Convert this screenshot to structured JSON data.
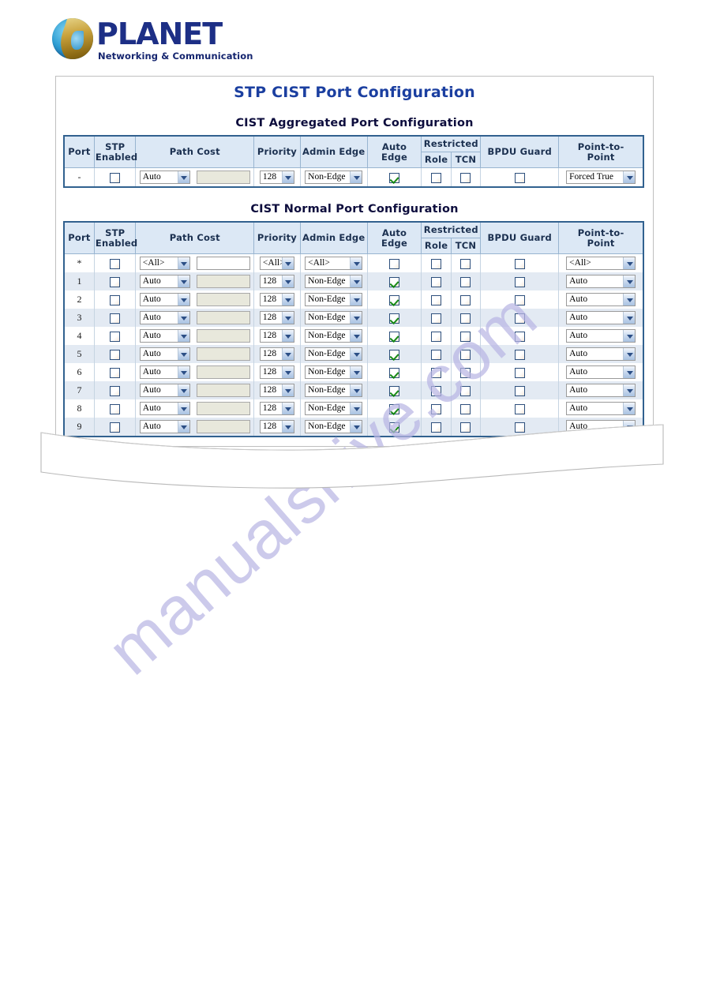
{
  "brand": {
    "name": "PLANET",
    "tagline": "Networking & Communication",
    "logo_icon": "planet-globe-icon",
    "word_color": "#1d2f86"
  },
  "watermark": {
    "text": "manualshive.com",
    "color": "#b9b6e4"
  },
  "page": {
    "title": "STP CIST Port Configuration",
    "title_color": "#1b3fa0"
  },
  "sections": [
    {
      "id": "aggregated",
      "title": "CIST Aggregated Port Configuration"
    },
    {
      "id": "normal",
      "title": "CIST Normal Port Configuration"
    }
  ],
  "table": {
    "headers": {
      "port": "Port",
      "stp_enabled": "STP Enabled",
      "stp_enabled_l1": "STP",
      "stp_enabled_l2": "Enabled",
      "path_cost": "Path Cost",
      "priority": "Priority",
      "admin_edge": "Admin Edge",
      "auto_edge": "Auto Edge",
      "restricted": "Restricted",
      "restricted_role": "Role",
      "restricted_tcn": "TCN",
      "bpdu_guard": "BPDU Guard",
      "point_to_point": "Point-to-Point",
      "point_to_point_l1": "Point-to-",
      "point_to_point_l2": "Point"
    },
    "header_bg": "#dce8f5",
    "border_color": "#31618f"
  },
  "aggregated_rows": [
    {
      "port": "-",
      "stp_enabled": false,
      "path_cost_select": "Auto",
      "path_cost_value": "",
      "path_cost_input_enabled": false,
      "priority": "128",
      "admin_edge": "Non-Edge",
      "auto_edge": true,
      "restricted_role": false,
      "restricted_tcn": false,
      "bpdu_guard": false,
      "point_to_point": "Forced True"
    }
  ],
  "normal_rows": [
    {
      "port": "*",
      "stp_enabled": false,
      "path_cost_select": "<All>",
      "path_cost_value": "",
      "path_cost_input_enabled": true,
      "priority": "<All>",
      "admin_edge": "<All>",
      "auto_edge": false,
      "restricted_role": false,
      "restricted_tcn": false,
      "bpdu_guard": false,
      "point_to_point": "<All>"
    },
    {
      "port": "1",
      "stp_enabled": false,
      "path_cost_select": "Auto",
      "path_cost_value": "",
      "path_cost_input_enabled": false,
      "priority": "128",
      "admin_edge": "Non-Edge",
      "auto_edge": true,
      "restricted_role": false,
      "restricted_tcn": false,
      "bpdu_guard": false,
      "point_to_point": "Auto"
    },
    {
      "port": "2",
      "stp_enabled": false,
      "path_cost_select": "Auto",
      "path_cost_value": "",
      "path_cost_input_enabled": false,
      "priority": "128",
      "admin_edge": "Non-Edge",
      "auto_edge": true,
      "restricted_role": false,
      "restricted_tcn": false,
      "bpdu_guard": false,
      "point_to_point": "Auto"
    },
    {
      "port": "3",
      "stp_enabled": false,
      "path_cost_select": "Auto",
      "path_cost_value": "",
      "path_cost_input_enabled": false,
      "priority": "128",
      "admin_edge": "Non-Edge",
      "auto_edge": true,
      "restricted_role": false,
      "restricted_tcn": false,
      "bpdu_guard": false,
      "point_to_point": "Auto"
    },
    {
      "port": "4",
      "stp_enabled": false,
      "path_cost_select": "Auto",
      "path_cost_value": "",
      "path_cost_input_enabled": false,
      "priority": "128",
      "admin_edge": "Non-Edge",
      "auto_edge": true,
      "restricted_role": false,
      "restricted_tcn": false,
      "bpdu_guard": false,
      "point_to_point": "Auto"
    },
    {
      "port": "5",
      "stp_enabled": false,
      "path_cost_select": "Auto",
      "path_cost_value": "",
      "path_cost_input_enabled": false,
      "priority": "128",
      "admin_edge": "Non-Edge",
      "auto_edge": true,
      "restricted_role": false,
      "restricted_tcn": false,
      "bpdu_guard": false,
      "point_to_point": "Auto"
    },
    {
      "port": "6",
      "stp_enabled": false,
      "path_cost_select": "Auto",
      "path_cost_value": "",
      "path_cost_input_enabled": false,
      "priority": "128",
      "admin_edge": "Non-Edge",
      "auto_edge": true,
      "restricted_role": false,
      "restricted_tcn": false,
      "bpdu_guard": false,
      "point_to_point": "Auto"
    },
    {
      "port": "7",
      "stp_enabled": false,
      "path_cost_select": "Auto",
      "path_cost_value": "",
      "path_cost_input_enabled": false,
      "priority": "128",
      "admin_edge": "Non-Edge",
      "auto_edge": true,
      "restricted_role": false,
      "restricted_tcn": false,
      "bpdu_guard": false,
      "point_to_point": "Auto"
    },
    {
      "port": "8",
      "stp_enabled": false,
      "path_cost_select": "Auto",
      "path_cost_value": "",
      "path_cost_input_enabled": false,
      "priority": "128",
      "admin_edge": "Non-Edge",
      "auto_edge": true,
      "restricted_role": false,
      "restricted_tcn": false,
      "bpdu_guard": false,
      "point_to_point": "Auto"
    },
    {
      "port": "9",
      "stp_enabled": false,
      "path_cost_select": "Auto",
      "path_cost_value": "",
      "path_cost_input_enabled": false,
      "priority": "128",
      "admin_edge": "Non-Edge",
      "auto_edge": true,
      "restricted_role": false,
      "restricted_tcn": false,
      "bpdu_guard": false,
      "point_to_point": "Auto"
    }
  ]
}
